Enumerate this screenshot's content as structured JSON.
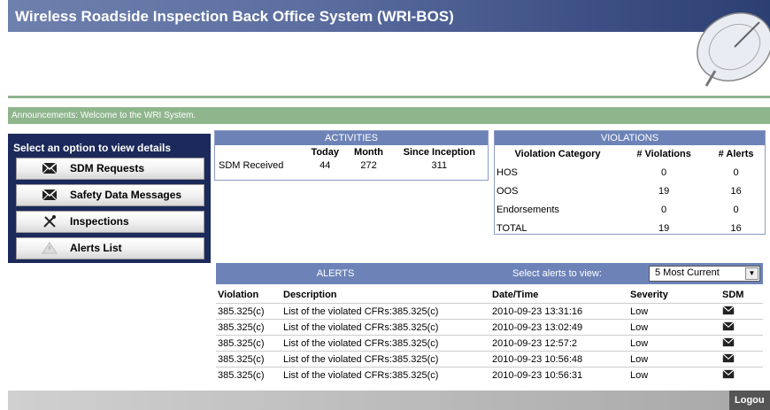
{
  "app": {
    "title": "Wireless Roadside Inspection Back Office System (WRI-BOS)"
  },
  "announcement": "Announcements: Welcome to the WRI System.",
  "sidebar": {
    "title": "Select an option to view details",
    "items": [
      {
        "label": "SDM Requests",
        "icon": "envelope-icon"
      },
      {
        "label": "Safety Data Messages",
        "icon": "envelope-icon"
      },
      {
        "label": "Inspections",
        "icon": "tools-icon"
      },
      {
        "label": "Alerts List",
        "icon": "warning-icon"
      }
    ]
  },
  "activities": {
    "title": "ACTIVITIES",
    "columns": [
      "Today",
      "Month",
      "Since Inception"
    ],
    "row": {
      "label": "SDM Received",
      "today": "44",
      "month": "272",
      "since": "311"
    }
  },
  "violations": {
    "title": "VIOLATIONS",
    "columns": [
      "Violation Category",
      "# Violations",
      "# Alerts"
    ],
    "rows": [
      {
        "category": "HOS",
        "violations": "0",
        "alerts": "0"
      },
      {
        "category": "OOS",
        "violations": "19",
        "alerts": "16"
      },
      {
        "category": "Endorsements",
        "violations": "0",
        "alerts": "0"
      },
      {
        "category": "TOTAL",
        "violations": "19",
        "alerts": "16"
      }
    ]
  },
  "alerts": {
    "title": "ALERTS",
    "select_label": "Select alerts to view:",
    "select_value": "5 Most Current",
    "columns": [
      "Violation",
      "Description",
      "Date/Time",
      "Severity",
      "SDM"
    ],
    "rows": [
      {
        "violation": "385.325(c)",
        "description": "List of the violated CFRs:385.325(c)",
        "datetime": "2010-09-23 13:31:16",
        "severity": "Low"
      },
      {
        "violation": "385.325(c)",
        "description": "List of the violated CFRs:385.325(c)",
        "datetime": "2010-09-23 13:02:49",
        "severity": "Low"
      },
      {
        "violation": "385.325(c)",
        "description": "List of the violated CFRs:385.325(c)",
        "datetime": "2010-09-23 12:57:2",
        "severity": "Low"
      },
      {
        "violation": "385.325(c)",
        "description": "List of the violated CFRs:385.325(c)",
        "datetime": "2010-09-23 10:56:48",
        "severity": "Low"
      },
      {
        "violation": "385.325(c)",
        "description": "List of the violated CFRs:385.325(c)",
        "datetime": "2010-09-23 10:56:31",
        "severity": "Low"
      }
    ]
  },
  "footer": {
    "logout_label": "Logou"
  }
}
